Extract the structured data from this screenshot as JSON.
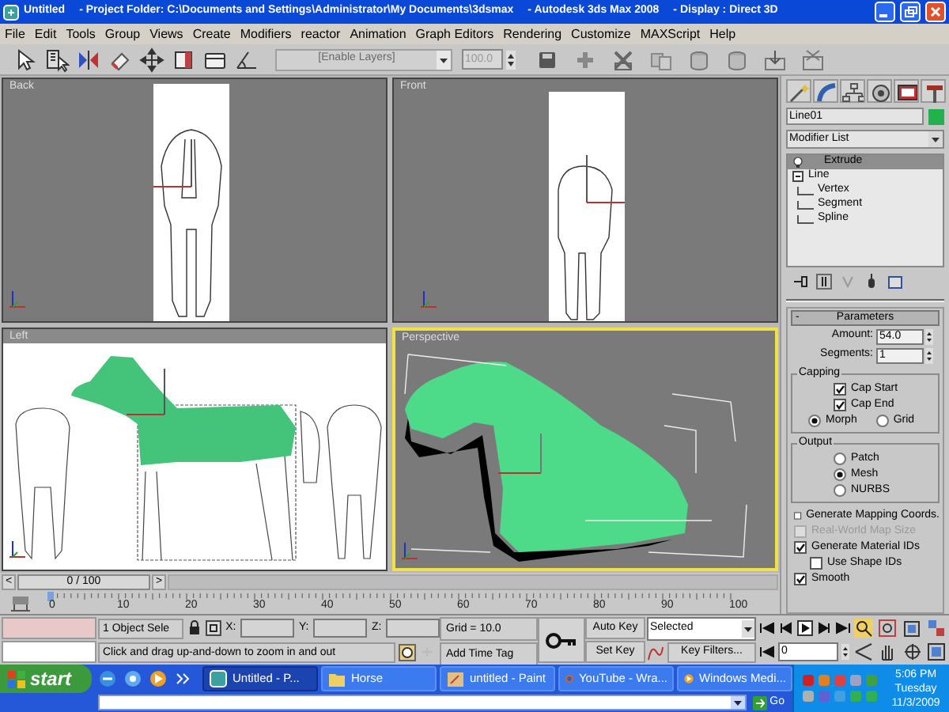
{
  "title_bar": {
    "parts": [
      "Untitled",
      "- Project Folder: C:\\Documents and Settings\\Administrator\\My Documents\\3dsmax",
      "- Autodesk 3ds Max 2008",
      "- Display : Direct 3D"
    ]
  },
  "menu_bar": [
    "File",
    "Edit",
    "Tools",
    "Group",
    "Views",
    "Create",
    "Modifiers",
    "reactor",
    "Animation",
    "Graph Editors",
    "Rendering",
    "Customize",
    "MAXScript",
    "Help"
  ],
  "toolbar": {
    "layer_dropdown": {
      "placeholder": "[Enable Layers]"
    },
    "spinner": "100.0"
  },
  "viewports": [
    {
      "label": "Back",
      "active": false
    },
    {
      "label": "Front",
      "active": false
    },
    {
      "label": "Left",
      "active": false
    },
    {
      "label": "Perspective",
      "active": true
    }
  ],
  "time_slider": {
    "prev": "<",
    "position": "0 / 100",
    "next": ">"
  },
  "track_bar": {
    "ticks": [
      "0",
      "10",
      "20",
      "30",
      "40",
      "50",
      "60",
      "70",
      "80",
      "90",
      "100"
    ]
  },
  "command_panel": {
    "object_name": "Line01",
    "modifier_list": "Modifier List",
    "stack": [
      {
        "label": "Extrude",
        "selected": true
      },
      {
        "label": "Line",
        "selected": false,
        "expanded": true,
        "children": [
          {
            "label": "Vertex",
            "selected": false
          },
          {
            "label": "Segment",
            "selected": false
          },
          {
            "label": "Spline",
            "selected": false
          }
        ]
      }
    ],
    "parameters": {
      "collapse": "-",
      "title": "Parameters",
      "amount": {
        "label": "Amount:",
        "value": "54.0"
      },
      "segments": {
        "label": "Segments:",
        "value": "1"
      },
      "capping": {
        "title": "Capping",
        "checkboxes": [
          {
            "label": "Cap Start",
            "checked": true
          },
          {
            "label": "Cap End",
            "checked": true
          }
        ],
        "radios": [
          {
            "label": "Morph",
            "selected": true
          },
          {
            "label": "Grid",
            "selected": false
          }
        ]
      },
      "output": {
        "title": "Output",
        "radios": [
          {
            "label": "Patch",
            "selected": false
          },
          {
            "label": "Mesh",
            "selected": true
          },
          {
            "label": "NURBS",
            "selected": false
          }
        ]
      },
      "options": [
        {
          "label": "Generate Mapping Coords.",
          "checked": false,
          "disabled": false
        },
        {
          "label": "Real-World Map Size",
          "checked": false,
          "disabled": true
        },
        {
          "label": "Generate Material IDs",
          "checked": true,
          "disabled": false,
          "children": [
            {
              "label": "Use Shape IDs",
              "checked": false,
              "disabled": false
            }
          ]
        },
        {
          "label": "Smooth",
          "checked": true,
          "disabled": false
        }
      ]
    }
  },
  "status_bar": {
    "selection": "1 Object Sele",
    "x_label": "X:",
    "y_label": "Y:",
    "z_label": "Z:",
    "grid": "Grid = 10.0",
    "prompt": "Click and drag up-and-down to zoom in and out",
    "add_time_tag": "Add Time Tag",
    "auto_key": "Auto Key",
    "set_key": "Set Key",
    "key_mode": "Selected",
    "key_filters": "Key Filters...",
    "frame": "0"
  },
  "taskbar": {
    "start": "start",
    "tasks": [
      {
        "label": "Untitled - P...",
        "selected": true
      },
      {
        "label": "Horse",
        "selected": false
      },
      {
        "label": "untitled - Paint",
        "selected": false
      },
      {
        "label": "YouTube - Wra...",
        "selected": false
      },
      {
        "label": "Windows Medi...",
        "selected": false
      }
    ],
    "go": "Go",
    "clock": {
      "time": "5:06 PM",
      "day": "Tuesday",
      "date": "11/3/2009"
    }
  }
}
